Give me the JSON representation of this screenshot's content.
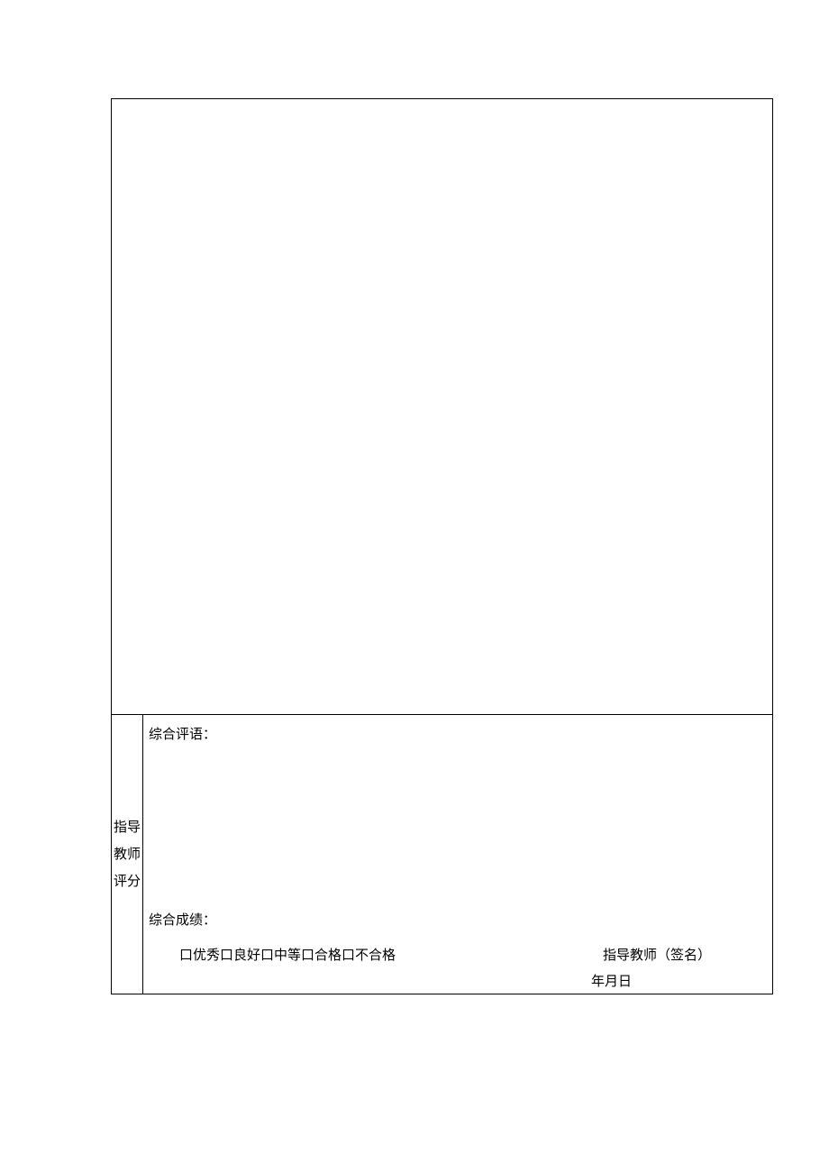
{
  "sidebar": {
    "line1": "指导",
    "line2": "教师",
    "line3": "评分"
  },
  "comment": {
    "label": "综合评语："
  },
  "grade": {
    "label": "综合成绩：",
    "options": "口优秀口良好口中等口合格口不合格",
    "signature": "指导教师（签名）",
    "date": "年月日"
  }
}
